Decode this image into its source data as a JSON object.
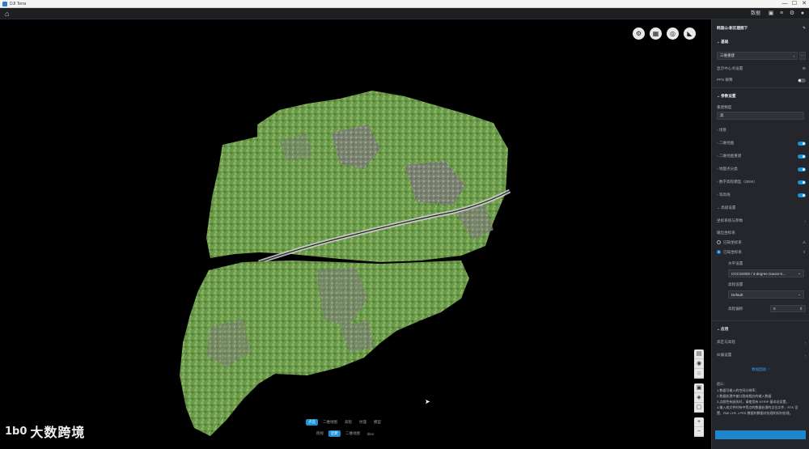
{
  "window": {
    "title": "DJI Terra",
    "minimize": "—",
    "maximize": "☐",
    "close": "✕"
  },
  "toolbar": {
    "right_label": "数据",
    "icons": [
      "cube-icon",
      "layers-icon",
      "gear-icon",
      "user-icon"
    ]
  },
  "viewport": {
    "top_buttons": [
      "settings-icon",
      "grid-icon",
      "compass-icon",
      "measure-icon"
    ],
    "side_tools": [
      "screenshot-icon",
      "camera-icon",
      "home-view-icon",
      "zoom-extent-icon",
      "target-icon",
      "fit-icon"
    ],
    "zoom": {
      "in": "+",
      "out": "−"
    },
    "bottom_tabs": [
      "点云",
      "二维地图",
      "高程",
      "纹理",
      "模型"
    ],
    "bottom_modes": [
      "俯视",
      "近距",
      "二维地图",
      "tiles"
    ],
    "watermark_mark": "1b0",
    "watermark_text": "大数跨境"
  },
  "panel": {
    "task_name": "韩国山-新区建图下",
    "section_base": "基础",
    "field_mode": "三维重建",
    "basic_settings": "显示中心点设置",
    "pps_label": "PPS 解算",
    "section_params": "参数设置",
    "label_resolution": "重建精度",
    "resolution_value": "高",
    "section_scene": "场景",
    "options": [
      {
        "label": "二维地图",
        "on": true
      },
      {
        "label": "二维地图重建",
        "on": true
      },
      {
        "label": "地面点分类",
        "on": true
      },
      {
        "label": "数字高程模型（DEM）",
        "on": true
      },
      {
        "label": "等高线",
        "on": true
      }
    ],
    "section_output": "高级设置",
    "custom_coord": "坐标系统与参数",
    "coord_system_label": "输出坐标系",
    "coord_option_1": "已知坐标系",
    "coord_option_2": "已知坐标系",
    "horizontal_label": "水平设置",
    "horizontal_value": "CGCS2000 / 3-degree Gauss-K...",
    "vertical_label": "高程设置",
    "vertical_value": "Default",
    "offset_label": "高程偏移",
    "offset_value": "0",
    "section_apply": "应用",
    "apply_item_1": "高区与高程",
    "apply_item_2": "纠偏设置",
    "link_label": "数据面板 ☞",
    "notes_title": "提示：",
    "notes": [
      "1.数据可输入的空间分辨率；",
      "2.数据处理中被分割成相应的输入数据",
      "3.点颜色有缺失时，请使用有 NTRIP 基本站设置，",
      "4.输入成文件时有中等点的数据处理的点位文件、RTK 设",
      "置、RMI LYR, LPRS 数据的数据对处理的如何处理。"
    ],
    "start_button": ""
  }
}
